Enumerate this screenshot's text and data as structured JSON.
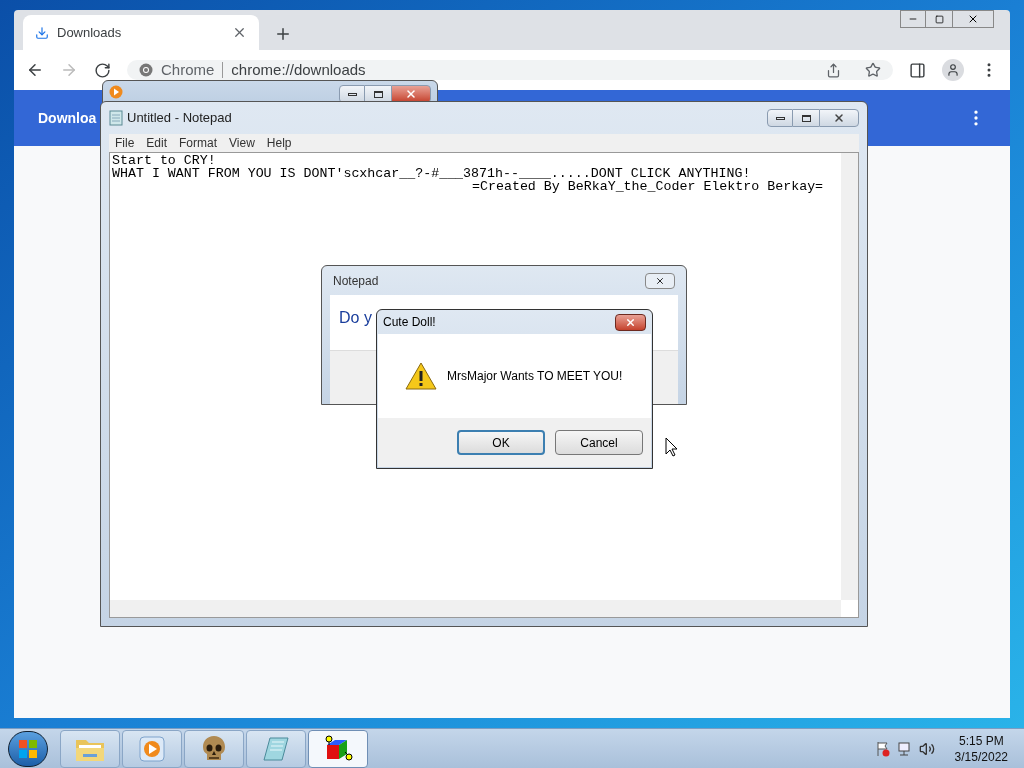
{
  "chrome": {
    "tab": {
      "title": "Downloads",
      "selected": true
    },
    "omnibox": {
      "site_label": "Chrome",
      "url": "chrome://downloads"
    },
    "header": {
      "title": "Downloa"
    }
  },
  "notepad": {
    "title": "Untitled - Notepad",
    "menu": [
      "File",
      "Edit",
      "Format",
      "View",
      "Help"
    ],
    "lines": [
      "Start to CRY!",
      "WHAT I WANT FROM YOU IS DONT'scxhcar__?-#___3871h--____.....DONT CLICK ANYTHING!"
    ],
    "signature": "=Created By BeRkaY_the_Coder Elektro Berkay="
  },
  "notepad_dialog": {
    "title": "Notepad",
    "message": "Do y"
  },
  "alert": {
    "title": "Cute Doll!",
    "message": "MrsMajor Wants TO MEET YOU!",
    "buttons": [
      {
        "label": "OK",
        "selected": true
      },
      {
        "label": "Cancel",
        "selected": false
      }
    ]
  },
  "taskbar": {
    "apps": [
      {
        "kind": "folder",
        "selected": false
      },
      {
        "kind": "media",
        "selected": false
      },
      {
        "kind": "skull",
        "selected": false
      },
      {
        "kind": "notepad",
        "selected": false
      },
      {
        "kind": "cube",
        "selected": true
      }
    ],
    "clock": {
      "time": "5:15 PM",
      "date": "3/15/2022"
    }
  }
}
